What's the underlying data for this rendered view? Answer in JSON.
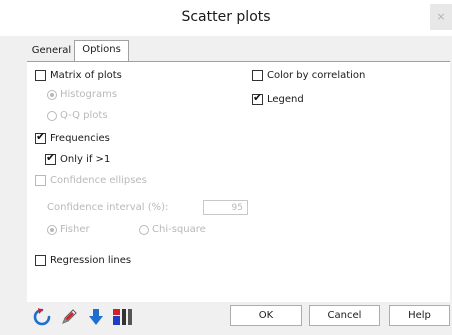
{
  "window": {
    "title": "Scatter plots",
    "close_glyph": "×"
  },
  "tabs": [
    {
      "label": "General",
      "active": false
    },
    {
      "label": "Options",
      "active": true
    }
  ],
  "options": {
    "matrix_of_plots": {
      "label": "Matrix of plots",
      "checked": false
    },
    "histograms": {
      "label": "Histograms",
      "selected": true,
      "enabled": false
    },
    "qq_plots": {
      "label": "Q-Q plots",
      "selected": false,
      "enabled": false
    },
    "frequencies": {
      "label": "Frequencies",
      "checked": true
    },
    "only_if_gt1": {
      "label": "Only if >1",
      "checked": true
    },
    "confidence_ellipses": {
      "label": "Confidence ellipses",
      "checked": false,
      "enabled": false
    },
    "confidence_interval": {
      "label": "Confidence interval (%):",
      "value": "95",
      "enabled": false
    },
    "fisher": {
      "label": "Fisher",
      "selected": true,
      "enabled": false
    },
    "chi_square": {
      "label": "Chi-square",
      "selected": false,
      "enabled": false
    },
    "regression_lines": {
      "label": "Regression lines",
      "checked": false
    },
    "color_by_correlation": {
      "label": "Color by correlation",
      "checked": false
    },
    "legend": {
      "label": "Legend",
      "checked": true
    }
  },
  "buttons": {
    "ok": "OK",
    "cancel": "Cancel",
    "help": "Help"
  },
  "toolbar_icons": [
    "reset-icon",
    "edit-icon",
    "down-arrow-icon",
    "color-palette-icon"
  ],
  "check_glyph": "✔",
  "colors": {
    "disabled_text": "#b9b9b9",
    "background": "#f0f0f0",
    "icon_blue": "#1f6fd0",
    "icon_red": "#d0202a"
  }
}
